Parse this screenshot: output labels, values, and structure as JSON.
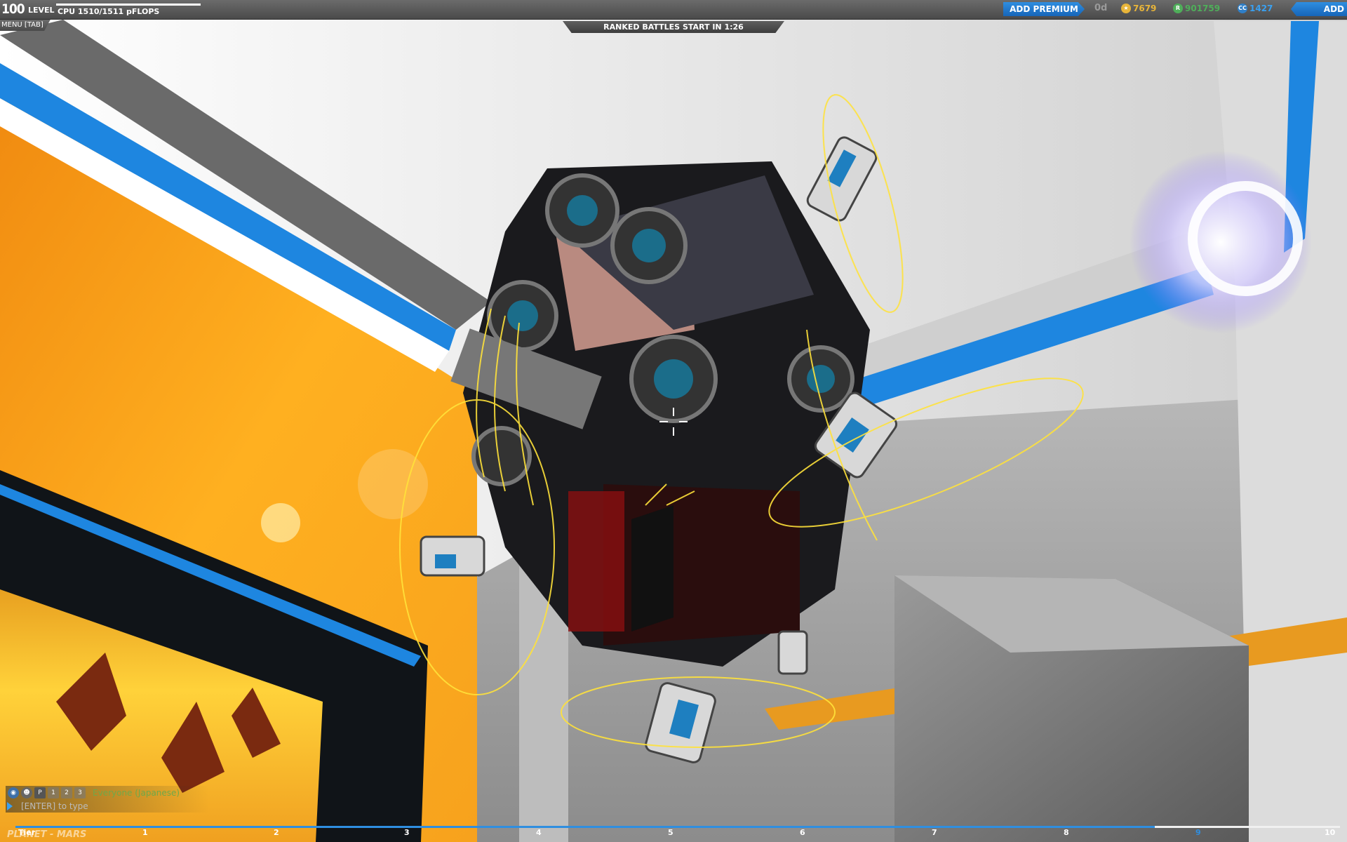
{
  "topbar": {
    "level_number": "100",
    "level_label": "LEVEL",
    "cpu_text": "CPU 1510/1511 pFLOPS",
    "cpu_fraction": 0.999,
    "add_premium": "ADD PREMIUM",
    "premium_days": "0d",
    "currency_robits": "7679",
    "currency_rp": "901759",
    "currency_cosmetic": "1427",
    "add_funds": "ADD FUNDS",
    "menu_tab": "MENU [TAB]"
  },
  "banner": {
    "ranked_text": "RANKED BATTLES START IN 1:26"
  },
  "chat": {
    "tab_icons": [
      "globe-icon",
      "group-icon",
      "P",
      "1",
      "2",
      "3"
    ],
    "channel": "Everyone (Japanese)",
    "input_placeholder": "[ENTER] to type"
  },
  "tier": {
    "label": "Tier",
    "numbers": [
      "1",
      "2",
      "3",
      "4",
      "5",
      "6",
      "7",
      "8",
      "9",
      "10"
    ],
    "progress_fraction": 0.86
  },
  "planet_text": "PLANET - MARS",
  "colors": {
    "accent_blue": "#2f8ee0",
    "highlight_yellow": "#ffe23a",
    "robits_gold": "#e8b53a",
    "rp_green": "#4fae5a",
    "cosmetic_blue": "#3aa0f0"
  }
}
